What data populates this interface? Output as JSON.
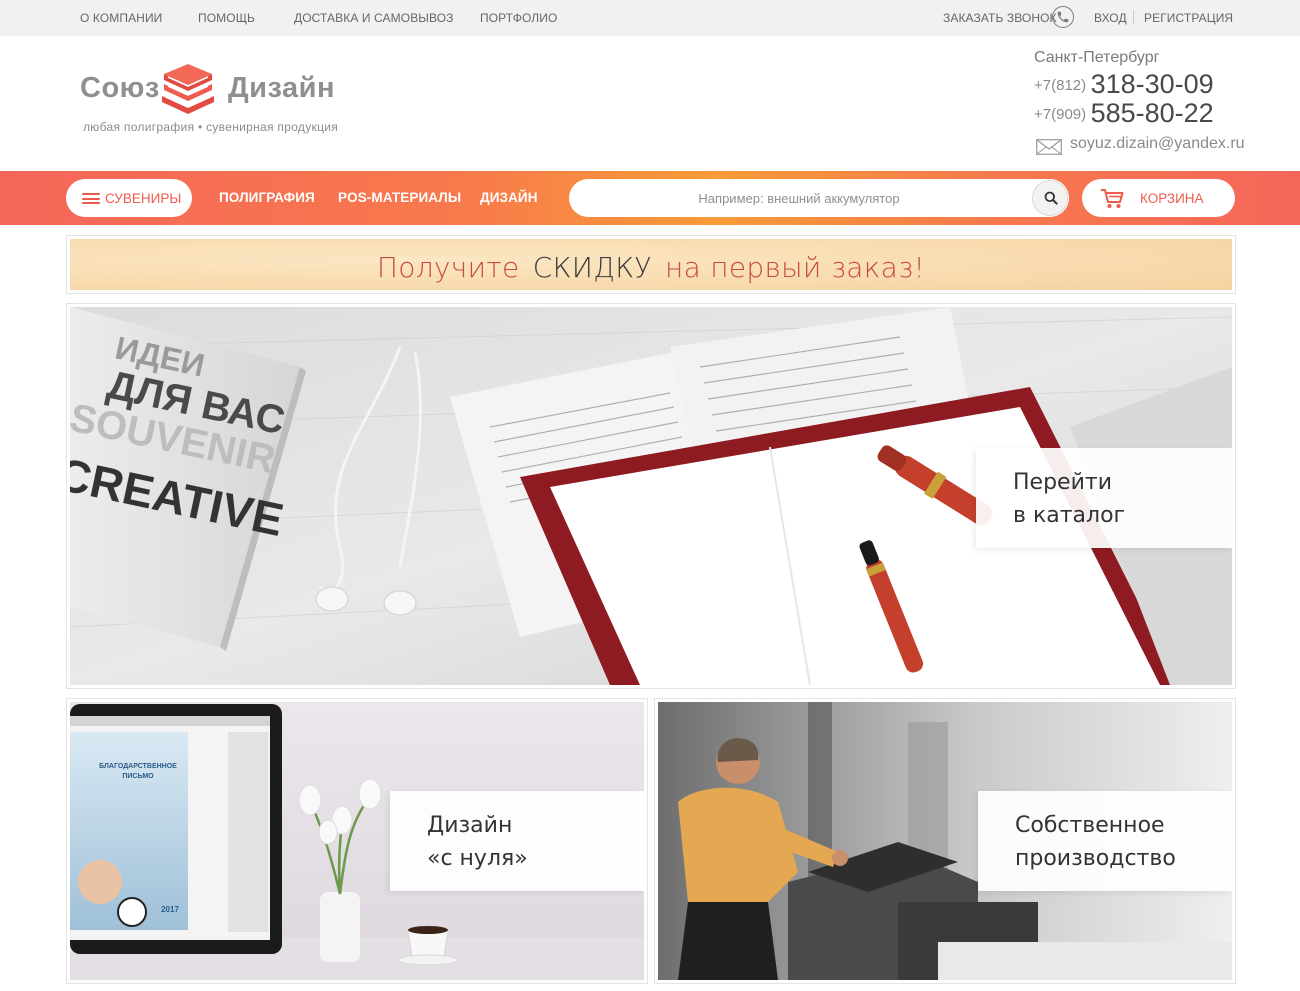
{
  "topbar": {
    "links": [
      "О КОМПАНИИ",
      "ПОМОЩЬ",
      "ДОСТАВКА И САМОВЫВОЗ",
      "ПОРТФОЛИО"
    ],
    "callback": "ЗАКАЗАТЬ ЗВОНОК",
    "login": "ВХОД",
    "register": "РЕГИСТРАЦИЯ"
  },
  "logo": {
    "word1": "Союз",
    "word2": "Дизайн",
    "tagline": "любая полиграфия • сувенирная продукция"
  },
  "contacts": {
    "city": "Санкт-Петербург",
    "phones": [
      {
        "code": "+7(812)",
        "number": "318-30-09"
      },
      {
        "code": "+7(909)",
        "number": "585-80-22"
      }
    ],
    "email": "soyuz.dizain@yandex.ru"
  },
  "nav": {
    "catalog_button": "СУВЕНИРЫ",
    "links": [
      "ПОЛИГРАФИЯ",
      "POS-МАТЕРИАЛЫ",
      "ДИЗАЙН"
    ],
    "search_placeholder": "Например: внешний аккумулятор",
    "cart": "КОРЗИНА"
  },
  "promo": {
    "part1": "Получите",
    "part2": "СКИДКУ",
    "part3": "на первый заказ!"
  },
  "banners": {
    "main": {
      "line1": "Перейти",
      "line2": "в каталог",
      "mock_text": [
        "ИДЕИ",
        "ДЛЯ ВАС",
        "SOUVENIR",
        "CREATIVE"
      ]
    },
    "design": {
      "line1": "Дизайн",
      "line2": "«с нуля»",
      "mock_text": [
        "БЛАГОДАРСТВЕННОЕ",
        "ПИСЬМО",
        "2017"
      ]
    },
    "production": {
      "line1": "Собственное",
      "line2": "производство"
    }
  },
  "colors": {
    "accent": "#ee5a4d",
    "nav_gradient_start": "#f5665a",
    "nav_gradient_mid": "#f99b37",
    "promo_bg": "#f8dcb0",
    "topbar_bg": "#f1f1f1"
  }
}
